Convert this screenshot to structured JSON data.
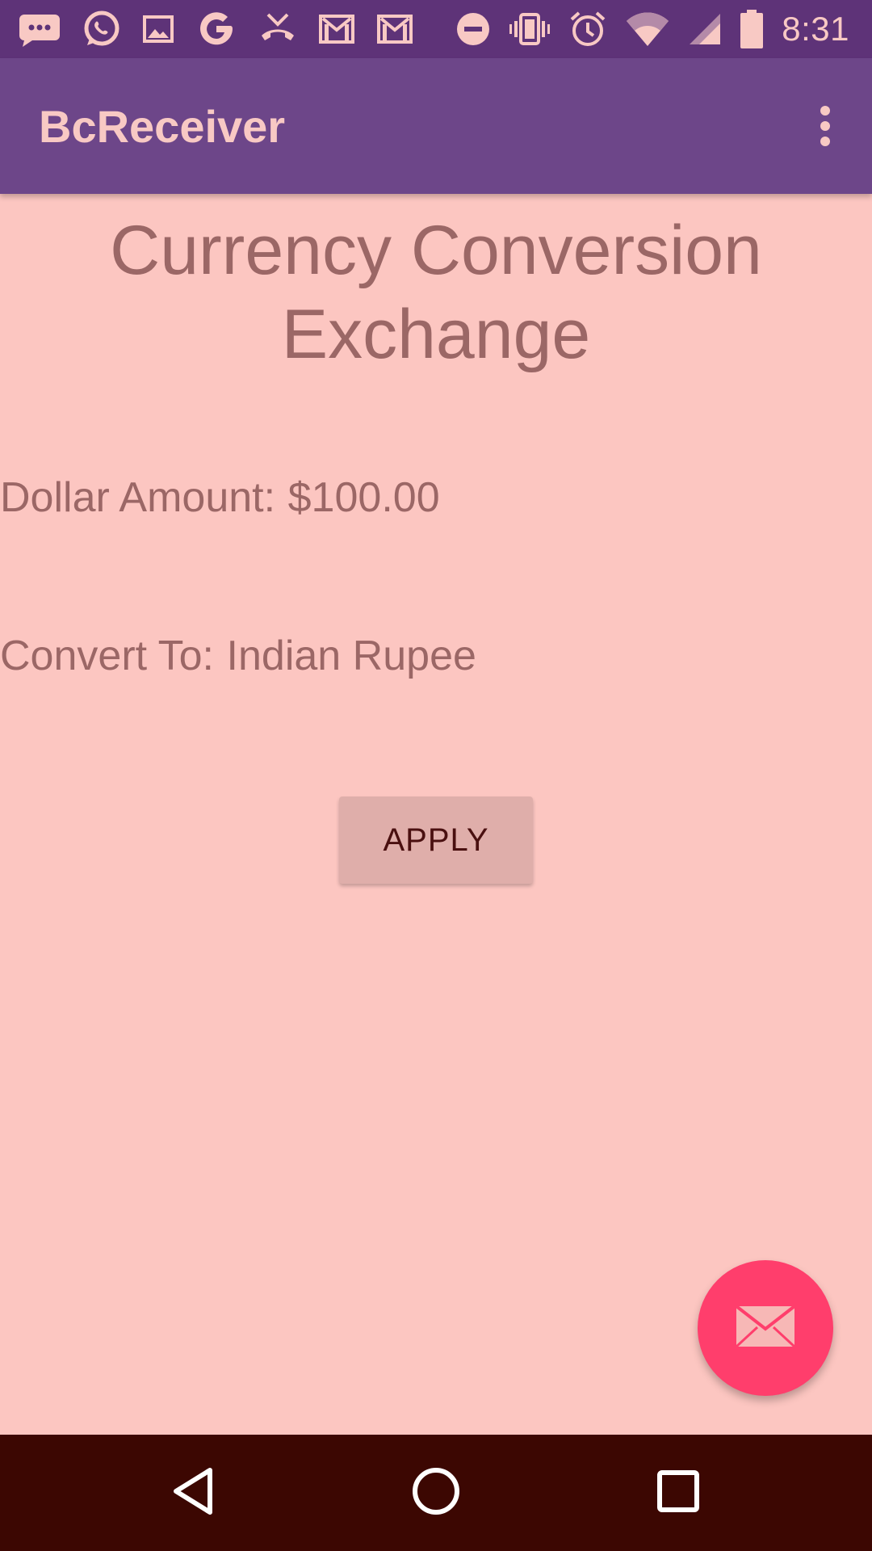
{
  "status_bar": {
    "time": "8:31",
    "left_icons": [
      "sms-icon",
      "whatsapp-icon",
      "gallery-icon",
      "google-icon",
      "missed-call-icon",
      "gmail-icon",
      "gmail-icon"
    ],
    "right_icons": [
      "do-not-disturb-icon",
      "vibrate-icon",
      "alarm-icon",
      "wifi-icon",
      "cell-signal-icon",
      "battery-icon"
    ]
  },
  "app_bar": {
    "title": "BcReceiver",
    "menu_icon": "more-vert-icon"
  },
  "main": {
    "headline": "Currency Conversion Exchange",
    "dollar_label": "Dollar Amount:",
    "dollar_value": "$100.00",
    "convert_label": "Convert To:",
    "convert_value": "Indian Rupee",
    "apply_label": "APPLY"
  },
  "fab": {
    "icon": "mail-icon"
  },
  "nav_bar": {
    "buttons": [
      "back-icon",
      "home-icon",
      "recents-icon"
    ]
  },
  "colors": {
    "status_bar": "#5e3378",
    "app_bar": "#6d4689",
    "background": "#fcc6c1",
    "text": "#9b6766",
    "button": "#dfaeaa",
    "fab": "#ff3e6c",
    "nav_bar": "#3c0702"
  }
}
